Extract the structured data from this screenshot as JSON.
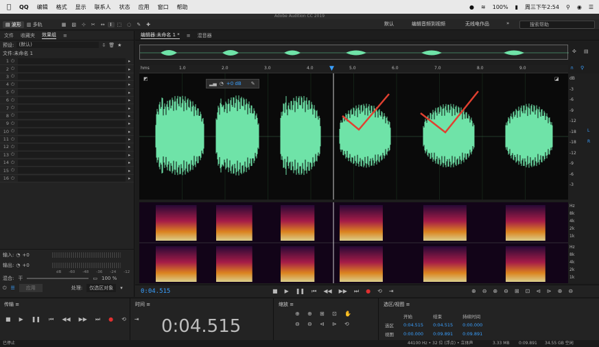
{
  "menubar": {
    "app": "QQ",
    "items": [
      "编辑",
      "格式",
      "显示",
      "联系人",
      "状态",
      "应用",
      "窗口",
      "帮助"
    ],
    "battery": "100%",
    "clock": "周三下午2:54"
  },
  "window_title": "Adobe Audition CC 2019",
  "toolbar": {
    "waveform_label": "波形",
    "multitrack_label": "多轨",
    "workspace_default": "默认",
    "workspace_edit_video": "编辑音频到视频",
    "workspace_radio": "无线电作品",
    "search_placeholder": "搜索帮助"
  },
  "left_panel": {
    "tabs": [
      "文件",
      "收藏夹",
      "效果组"
    ],
    "preset_label": "预设:",
    "preset_value": "(默认)",
    "file_label": "文件:未命名 1",
    "rack_slots": [
      "1",
      "2",
      "3",
      "4",
      "5",
      "6",
      "7",
      "8",
      "9",
      "10",
      "11",
      "12",
      "13",
      "14",
      "15",
      "16"
    ],
    "input_label": "输入:",
    "output_label": "输出:",
    "input_db": "+0",
    "output_db": "+0",
    "meter_ticks": [
      "dB",
      "-60",
      "-48",
      "-36",
      "-24",
      "-12",
      "0"
    ],
    "mix_label": "混合:",
    "mix_dry": "干",
    "mix_wet_pct": "100 %",
    "apply_button": "应用",
    "process_label": "处理:",
    "process_value": "仅选区对象"
  },
  "editor": {
    "tab_editor": "编辑器:未命名 1 *",
    "tab_mixer": "混音器",
    "ruler_unit": "hms",
    "ruler_ticks": [
      "1.0",
      "2.0",
      "3.0",
      "4.0",
      "5.0",
      "6.0",
      "7.0",
      "8.0",
      "9.0"
    ],
    "hud_gain": "+0 dB",
    "db_scale": [
      "dB",
      "-3",
      "-6",
      "-9",
      "-12",
      "-18",
      "-18",
      "-12",
      "-9",
      "-6",
      "-3"
    ],
    "hz_scale_top": [
      "Hz",
      "8k",
      "4k",
      "2k",
      "1k"
    ],
    "hz_scale_bottom": [
      "Hz",
      "8k",
      "4k",
      "2k",
      "1k"
    ],
    "current_time_small": "0:04.515"
  },
  "transport_panel": {
    "title": "传输"
  },
  "time_panel": {
    "title": "时间",
    "current_time": "0:04.515"
  },
  "zoom_panel": {
    "title": "缩放"
  },
  "selection_panel": {
    "title": "选区/视图",
    "col_start": "开始",
    "col_end": "结束",
    "col_duration": "持续时间",
    "row_selection": "选区",
    "row_view": "视图",
    "sel_start": "0:04.515",
    "sel_end": "0:04.515",
    "sel_duration": "0:00.000",
    "view_start": "0:00.000",
    "view_end": "0:09.891",
    "view_duration": "0:09.891"
  },
  "status": {
    "left": "已停止",
    "sample_rate": "44100 Hz • 32 位 (浮点) • 立体声",
    "size": "3.33 MB",
    "duration": "0:09.891",
    "free_space": "34.55 GB 空闲"
  }
}
